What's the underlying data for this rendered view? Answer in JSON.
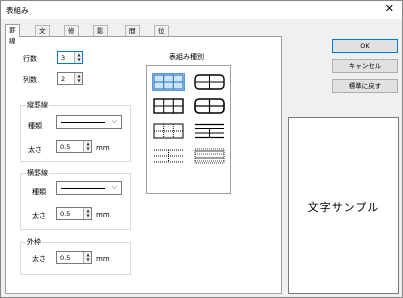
{
  "window": {
    "title": "表組み",
    "close_icon": "close-icon"
  },
  "tabs": [
    "罫線",
    "文字",
    "修飾",
    "影",
    "間隔",
    "位置"
  ],
  "rows": {
    "label": "行数",
    "value": "3"
  },
  "cols": {
    "label": "列数",
    "value": "2"
  },
  "vertical": {
    "title": "縦罫線",
    "type_label": "種類",
    "width_label": "太さ",
    "width_value": "0.5",
    "unit": "mm"
  },
  "horizontal": {
    "title": "横罫線",
    "type_label": "種類",
    "width_label": "太さ",
    "width_value": "0.5",
    "unit": "mm"
  },
  "outer": {
    "title": "外枠",
    "width_label": "太さ",
    "width_value": "0.5",
    "unit": "mm"
  },
  "table_types": {
    "title": "表組み種別"
  },
  "buttons": {
    "ok": "OK",
    "cancel": "キャンセル",
    "reset": "標準に戻す"
  },
  "sample": {
    "text": "文字サンプル"
  }
}
